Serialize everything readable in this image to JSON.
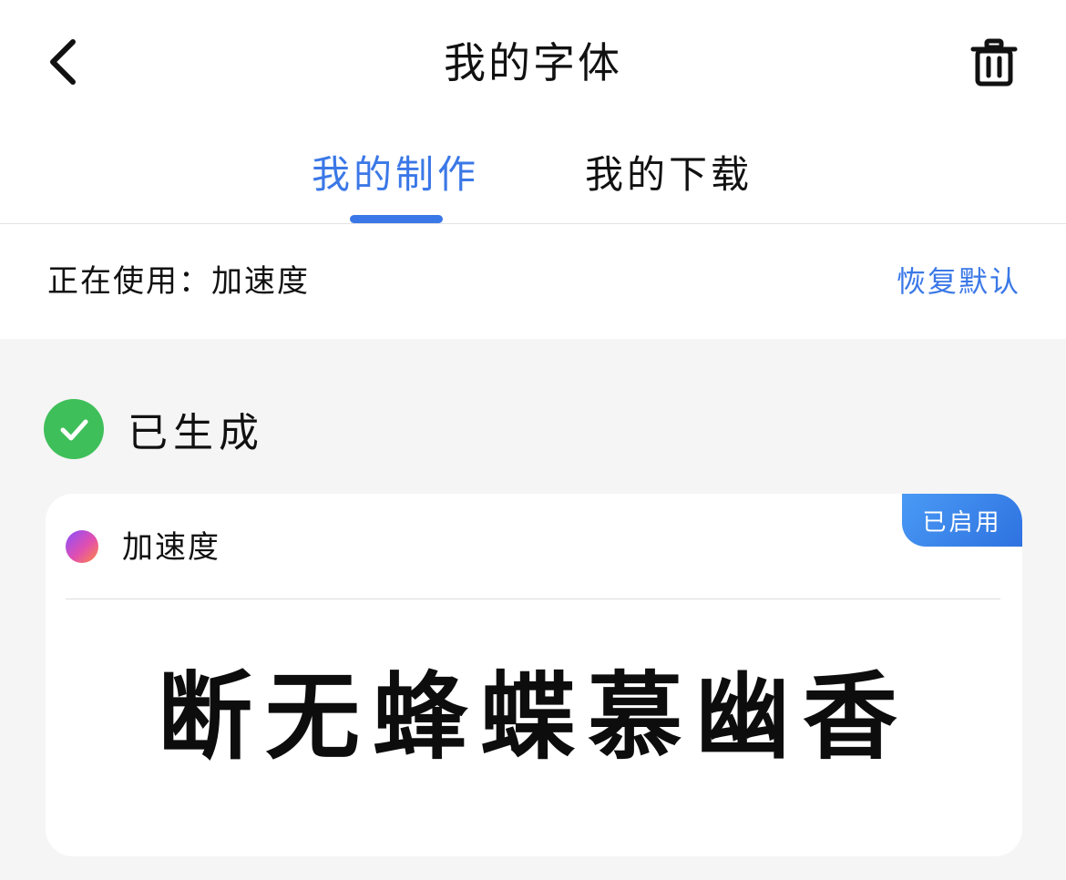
{
  "header": {
    "title": "我的字体",
    "back_icon": "chevron-left-icon",
    "delete_icon": "trash-icon"
  },
  "tabs": [
    {
      "label": "我的制作",
      "active": true
    },
    {
      "label": "我的下载",
      "active": false
    }
  ],
  "current": {
    "label": "正在使用：加速度",
    "restore_label": "恢复默认"
  },
  "status": {
    "icon": "check-circle-icon",
    "text": "已生成"
  },
  "font_card": {
    "name": "加速度",
    "badge": "已启用",
    "sample_text": "断无蜂蝶慕幽香"
  },
  "colors": {
    "accent": "#3b78e7",
    "success": "#3fbf5a",
    "background": "#f5f5f5"
  }
}
